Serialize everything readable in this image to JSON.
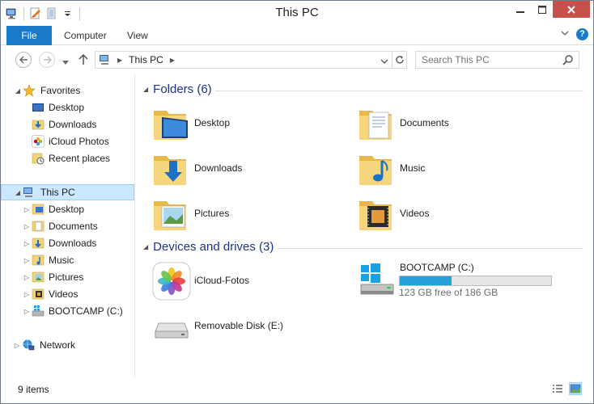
{
  "window": {
    "title": "This PC"
  },
  "ribbon": {
    "tabs": [
      {
        "label": "File"
      },
      {
        "label": "Computer"
      },
      {
        "label": "View"
      }
    ],
    "help_glyph": "?"
  },
  "address": {
    "path": "This PC",
    "search_placeholder": "Search This PC"
  },
  "nav": {
    "favorites": {
      "label": "Favorites",
      "items": [
        {
          "label": "Desktop"
        },
        {
          "label": "Downloads"
        },
        {
          "label": "iCloud Photos"
        },
        {
          "label": "Recent places"
        }
      ]
    },
    "thispc": {
      "label": "This PC",
      "items": [
        {
          "label": "Desktop"
        },
        {
          "label": "Documents"
        },
        {
          "label": "Downloads"
        },
        {
          "label": "Music"
        },
        {
          "label": "Pictures"
        },
        {
          "label": "Videos"
        },
        {
          "label": "BOOTCAMP (C:)"
        }
      ]
    },
    "network": {
      "label": "Network"
    }
  },
  "folders": {
    "heading": "Folders (6)",
    "items": [
      {
        "label": "Desktop",
        "icon": "desktop-folder-icon"
      },
      {
        "label": "Documents",
        "icon": "documents-folder-icon"
      },
      {
        "label": "Downloads",
        "icon": "downloads-folder-icon"
      },
      {
        "label": "Music",
        "icon": "music-folder-icon"
      },
      {
        "label": "Pictures",
        "icon": "pictures-folder-icon"
      },
      {
        "label": "Videos",
        "icon": "videos-folder-icon"
      }
    ]
  },
  "devices": {
    "heading": "Devices and drives (3)",
    "items": [
      {
        "label": "iCloud-Fotos",
        "icon": "icloud-photos-icon"
      },
      {
        "label": "BOOTCAMP (C:)",
        "icon": "windows-drive-icon",
        "free_text": "123 GB free of 186 GB",
        "used_fraction": 0.34
      },
      {
        "label": "Removable Disk (E:)",
        "icon": "removable-disk-icon"
      }
    ]
  },
  "status": {
    "items_text": "9 items"
  },
  "colors": {
    "accent": "#1979ca",
    "close": "#c7504a",
    "drive_fill": "#26a0da",
    "selection": "#cce8ff"
  }
}
